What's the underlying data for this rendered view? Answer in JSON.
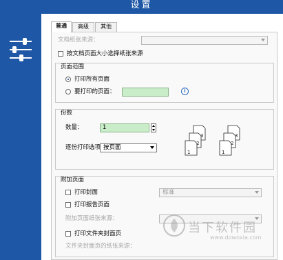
{
  "window": {
    "title": "设置"
  },
  "sidebar": {
    "icon": "sliders-icon"
  },
  "tabs": [
    {
      "label": "普通",
      "active": true
    },
    {
      "label": "高级",
      "active": false
    },
    {
      "label": "其他",
      "active": false
    }
  ],
  "paper_source": {
    "label": "文档纸张来源：",
    "value": ""
  },
  "choose_by_size": {
    "label": "按文档页面大小选择纸张来源",
    "checked": false
  },
  "page_range": {
    "title": "页面范围",
    "all_pages_label": "打印所有页面",
    "pages_label": "要打印的页面：",
    "pages_value": "",
    "selected": "all"
  },
  "copies": {
    "title": "份数",
    "count_label": "数量：",
    "count_value": "1",
    "collate_label": "逐份打印选项：",
    "collate_value": "按页面",
    "stack_left": [
      "3",
      "2",
      "1"
    ],
    "stack_right": [
      "3",
      "2",
      "1"
    ]
  },
  "extra_pages": {
    "title": "附加页面",
    "cover_label": "打印封面",
    "cover_checked": false,
    "cover_value": "标准",
    "report_label": "打印报告页面",
    "report_checked": false,
    "extra_source_label": "附加页面纸张来源：",
    "folder_cover_label": "打印文件夹封面页",
    "folder_cover_checked": false,
    "folder_source_label": "文件夹封面页的纸张来源："
  },
  "watermark": {
    "text": "当下软件园",
    "url": "www.downxia.com"
  },
  "colors": {
    "brand_blue": "#1e57a6",
    "input_green": "#c9ecc9"
  }
}
